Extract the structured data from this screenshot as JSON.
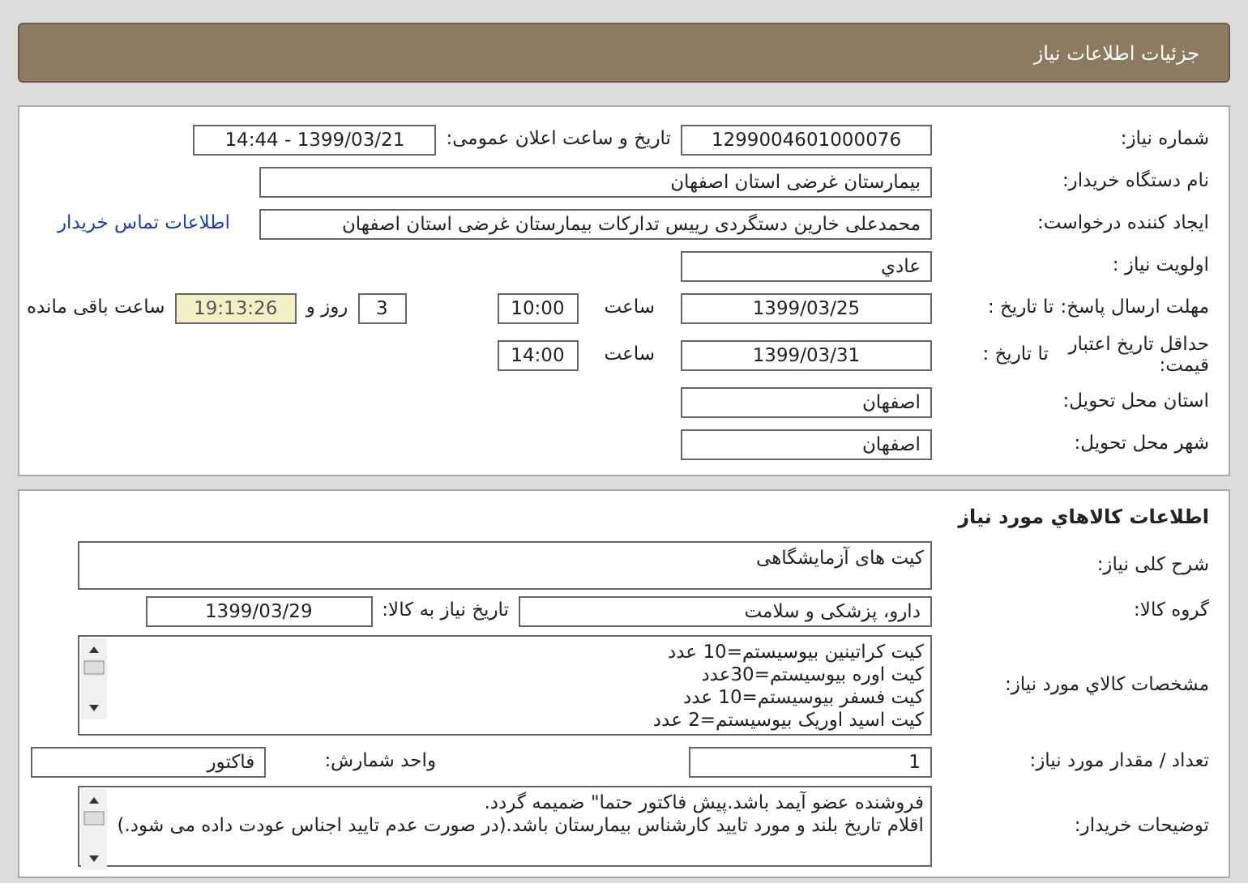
{
  "header": {
    "title": "جزئیات اطلاعات نیاز"
  },
  "need_info": {
    "number_label": "شماره نیاز:",
    "number": "1299004601000076",
    "announce_label": "تاریخ و ساعت اعلان عمومی:",
    "announce": "1399/03/21 - 14:44",
    "buyer_label": "نام دستگاه خریدار:",
    "buyer": "بیمارستان غرضی استان اصفهان",
    "requester_label": "ایجاد کننده درخواست:",
    "requester": "محمدعلی خارین دستگردی رییس تدارکات بیمارستان غرضی استان اصفهان",
    "contact_link": "اطلاعات تماس خریدار",
    "priority_label": "اولویت نیاز :",
    "priority": "عادي",
    "deadline_label": "مهلت ارسال پاسخ:",
    "deadline_to_label": "تا تاریخ :",
    "deadline_date": "1399/03/25",
    "deadline_hour_label": "ساعت",
    "deadline_time": "10:00",
    "days": "3",
    "days_label": "روز و",
    "remaining_time": "19:13:26",
    "remaining_label": "ساعت باقی مانده",
    "validity_label": "حداقل تاریخ اعتبار قیمت:",
    "validity_to_label": "تا تاریخ :",
    "validity_date": "1399/03/31",
    "validity_hour_label": "ساعت",
    "validity_time": "14:00",
    "province_label": "استان محل تحویل:",
    "province": "اصفهان",
    "city_label": "شهر محل تحویل:",
    "city": "اصفهان"
  },
  "goods": {
    "title": "اطلاعات کالاهاي مورد نياز",
    "description_label": "شرح کلی نیاز:",
    "description": "کیت های آزمایشگاهی",
    "group_label": "گروه کالا:",
    "group": "دارو، پزشکی و سلامت",
    "need_date_label": "تاریخ نیاز به کالا:",
    "need_date": "1399/03/29",
    "specs_label": "مشخصات کالاي مورد نياز:",
    "specs": [
      "کیت کراتینین بیوسیستم=10 عدد",
      "کیت اوره بیوسیستم=30عدد",
      "کیت فسفر بیوسیستم=10 عدد",
      "کیت اسید اوریک بیوسیستم=2 عدد"
    ],
    "quantity_label": "تعداد / مقدار مورد نیاز:",
    "quantity": "1",
    "unit_label": "واحد شمارش:",
    "unit": "فاکتور",
    "notes_label": "توضیحات خریدار:",
    "notes": [
      "فروشنده عضو آیمد باشد.پیش فاکتور حتما\" ضمیمه گردد.",
      "اقلام تاریخ بلند و مورد تایید کارشناس بیمارستان باشد.(در صورت عدم تایید اجناس عودت داده می شود.)"
    ]
  }
}
